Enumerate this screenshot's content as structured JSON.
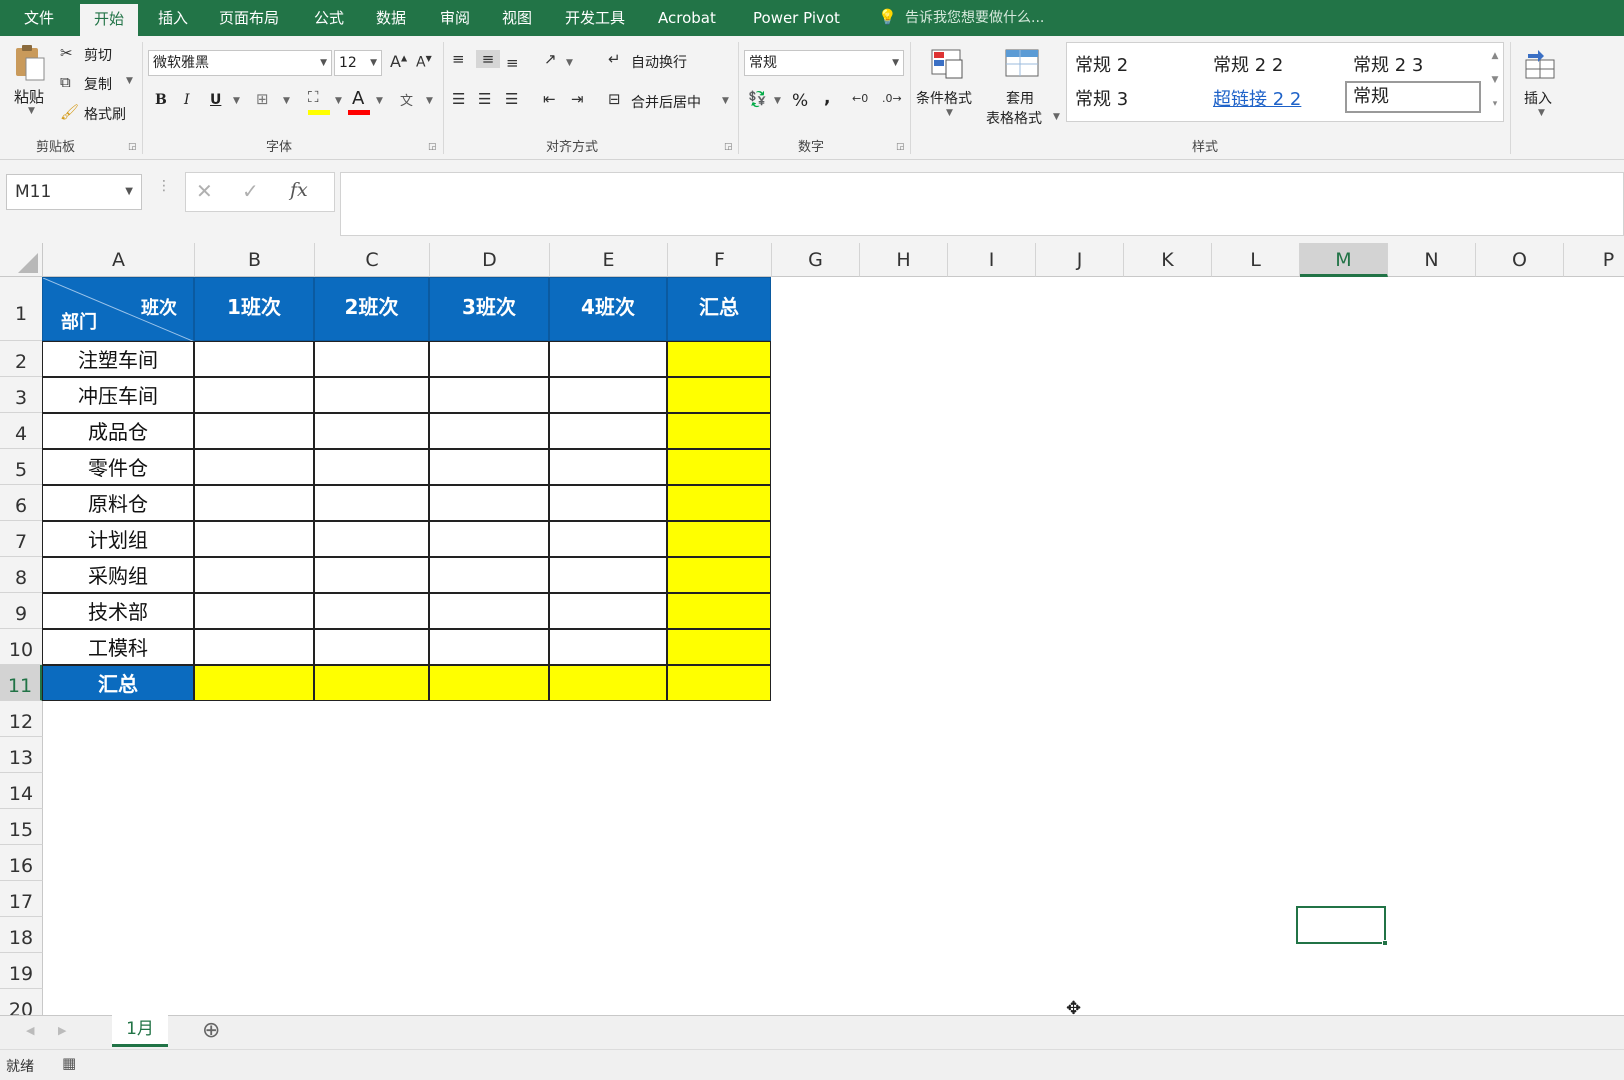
{
  "menu": {
    "tabs": [
      "文件",
      "开始",
      "插入",
      "页面布局",
      "公式",
      "数据",
      "审阅",
      "视图",
      "开发工具",
      "Acrobat",
      "Power Pivot"
    ],
    "active_tab": "开始",
    "tell_me": "告诉我您想要做什么..."
  },
  "ribbon": {
    "clipboard": {
      "paste": "粘贴",
      "cut": "剪切",
      "copy": "复制",
      "format_painter": "格式刷",
      "label": "剪贴板"
    },
    "font": {
      "name": "微软雅黑",
      "size": "12",
      "label": "字体",
      "bold": "B",
      "italic": "I",
      "underline": "U",
      "font_color_glyph": "A",
      "fill_color": "#ffff00",
      "text_color": "#ff0000"
    },
    "alignment": {
      "wrap": "自动换行",
      "merge": "合并后居中",
      "label": "对齐方式"
    },
    "number": {
      "format": "常规",
      "percent": "%",
      "comma": ",",
      "label": "数字"
    },
    "styles": {
      "conditional": "条件格式",
      "table_format_1": "套用",
      "table_format_2": "表格格式",
      "cells": [
        "常规 2",
        "常规 2 2",
        "常规 2 3",
        "常规 3",
        "超链接 2 2",
        "常规"
      ],
      "label": "样式"
    },
    "cells_group": {
      "insert": "插入"
    }
  },
  "formula_bar": {
    "name_box": "M11",
    "cancel": "✕",
    "enter": "✓",
    "fx": "fx",
    "value": ""
  },
  "sheet": {
    "columns": [
      "A",
      "B",
      "C",
      "D",
      "E",
      "F",
      "G",
      "H",
      "I",
      "J",
      "K",
      "L",
      "M",
      "N",
      "O",
      "P"
    ],
    "selected_column": "M",
    "rows": [
      "1",
      "2",
      "3",
      "4",
      "5",
      "6",
      "7",
      "8",
      "9",
      "10",
      "11",
      "12",
      "13",
      "14",
      "15",
      "16",
      "17",
      "18",
      "19",
      "20"
    ],
    "selected_row": "11",
    "selected_cell": "M11",
    "table": {
      "corner_left": "部门",
      "corner_right": "班次",
      "headers": [
        "1班次",
        "2班次",
        "3班次",
        "4班次",
        "汇总"
      ],
      "departments": [
        "注塑车间",
        "冲压车间",
        "成品仓",
        "零件仓",
        "原料仓",
        "计划组",
        "采购组",
        "技术部",
        "工模科"
      ],
      "total_label": "汇总"
    },
    "colors": {
      "header_blue": "#0b6bbf",
      "highlight_yellow": "#ffff00",
      "accent_green": "#217346"
    }
  },
  "sheet_tabs": {
    "active": "1月",
    "add": "⊕"
  },
  "status": {
    "ready": "就绪"
  }
}
